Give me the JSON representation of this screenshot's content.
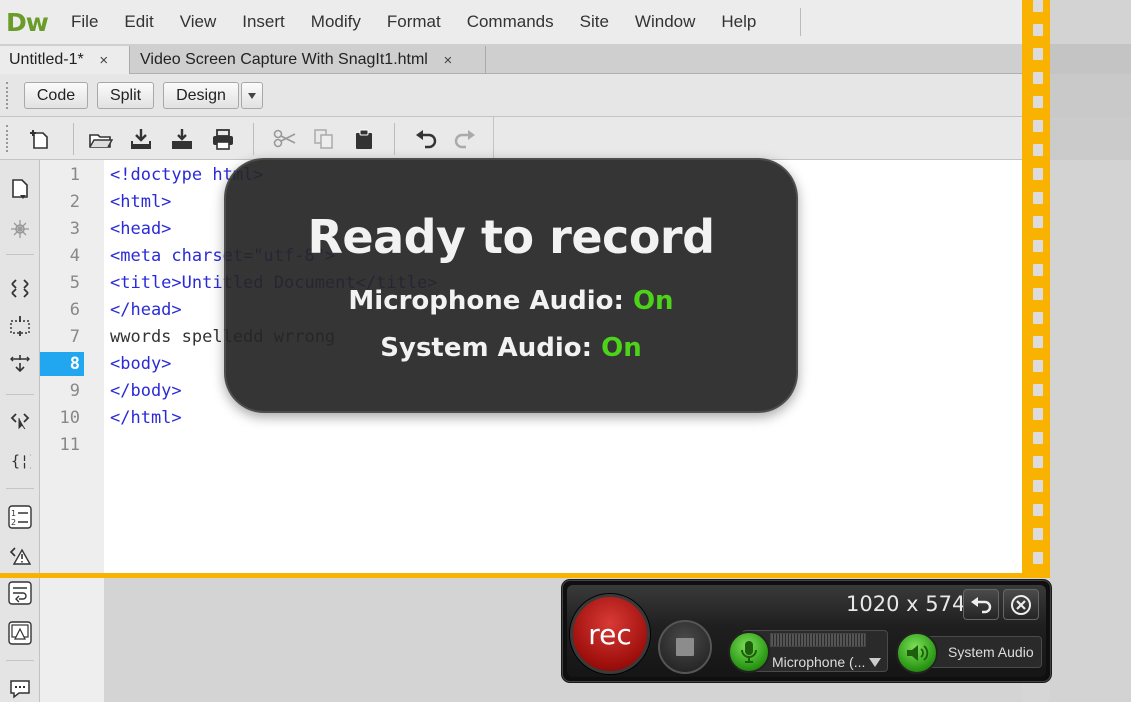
{
  "app": {
    "logo": "Dw"
  },
  "menu": [
    "File",
    "Edit",
    "View",
    "Insert",
    "Modify",
    "Format",
    "Commands",
    "Site",
    "Window",
    "Help"
  ],
  "tabs": [
    {
      "label": "Untitled-1*",
      "close": "×",
      "active": true
    },
    {
      "label": "Video Screen Capture With SnagIt1.html",
      "close": "×",
      "active": false
    }
  ],
  "view_buttons": {
    "code": "Code",
    "split": "Split",
    "design": "Design"
  },
  "toolbar_icons": [
    "new-document-icon",
    "open-folder-icon",
    "save-icon",
    "save-all-icon",
    "print-icon",
    "cut-icon",
    "copy-icon",
    "paste-icon",
    "undo-icon",
    "redo-icon"
  ],
  "editor": {
    "current_line": 8,
    "line_numbers": [
      "1",
      "2",
      "3",
      "4",
      "5",
      "6",
      "7",
      "8",
      "9",
      "10",
      "11"
    ],
    "lines": [
      "<!doctype html>",
      "<html>",
      "<head>",
      "<meta charset=\"utf-8\">",
      "<title>Untitled Document</title>",
      "</head>",
      "wwords spelledd wrrong",
      "<body>",
      "</body>",
      "</html>",
      ""
    ]
  },
  "overlay": {
    "title": "Ready to record",
    "mic_label": "Microphone Audio:",
    "mic_state": "On",
    "sys_label": "System Audio:",
    "sys_state": "On"
  },
  "recorder": {
    "dimensions": "1020 x 574",
    "rec_label": "rec",
    "microphone_label": "Microphone (...",
    "system_audio_label": "System Audio"
  },
  "colors": {
    "capture_border": "#f9b200",
    "on_green": "#4cd31a",
    "current_line": "#20a7f0",
    "rec_red": "#c0211c"
  }
}
